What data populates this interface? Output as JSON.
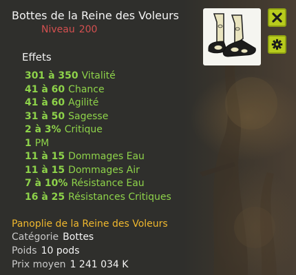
{
  "item": {
    "name": "Bottes de la Reine des Voleurs",
    "level_label": "Niveau",
    "level_value": "200"
  },
  "effects_title": "Effets",
  "effects": [
    {
      "value": "301 à 350",
      "name": "Vitalité"
    },
    {
      "value": "41 à 60",
      "name": "Chance"
    },
    {
      "value": "41 à 60",
      "name": "Agilité"
    },
    {
      "value": "31 à 50",
      "name": "Sagesse"
    },
    {
      "value": "2 à 3%",
      "name": "Critique"
    },
    {
      "value": "1",
      "name": "PM"
    },
    {
      "value": "11 à 15",
      "name": "Dommages Eau"
    },
    {
      "value": "11 à 15",
      "name": "Dommages Air"
    },
    {
      "value": "7 à 10%",
      "name": "Résistance Eau"
    },
    {
      "value": "16 à 25",
      "name": "Résistances Critiques"
    }
  ],
  "set_name": "Panoplie de la Reine des Voleurs",
  "info": {
    "category_label": "Catégorie",
    "category_value": "Bottes",
    "weight_label": "Poids",
    "weight_value": "10 pods",
    "price_label": "Prix moyen",
    "price_value": "1 241 034 K"
  },
  "icons": {
    "close": "close-icon",
    "settings": "gear-icon",
    "item": "boots-icon"
  },
  "colors": {
    "effect": "#8ed34a",
    "level": "#d45050",
    "set": "#f0b82e",
    "button": "#b8cc1d"
  }
}
